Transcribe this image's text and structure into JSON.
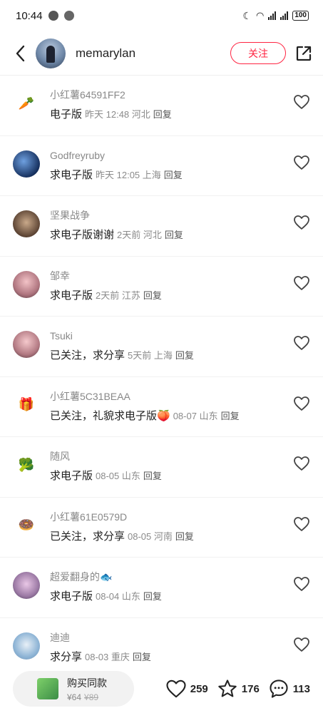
{
  "status_bar": {
    "time": "10:44",
    "battery": "100"
  },
  "header": {
    "username": "memarylan",
    "follow_label": "关注"
  },
  "comments": [
    {
      "name": "小红薯64591FF2",
      "text": "电子版",
      "meta": "昨天 12:48 河北",
      "reply": "回复",
      "avatar": "carrot-avatar",
      "emoji": "🥕"
    },
    {
      "name": "Godfreyruby",
      "text": "求电子版",
      "meta": "昨天 12:05 上海",
      "reply": "回复",
      "avatar": "photo-avatar",
      "emoji": ""
    },
    {
      "name": "坚果战争",
      "text": "求电子版谢谢",
      "meta": "2天前 河北",
      "reply": "回复",
      "avatar": "photo-avatar",
      "emoji": ""
    },
    {
      "name": "邹幸",
      "text": "求电子版",
      "meta": "2天前 江苏",
      "reply": "回复",
      "avatar": "photo-avatar",
      "emoji": ""
    },
    {
      "name": "Tsuki",
      "text": "已关注，求分享",
      "meta": "5天前 上海",
      "reply": "回复",
      "avatar": "photo-avatar",
      "emoji": ""
    },
    {
      "name": "小红薯5C31BEAA",
      "text": "已关注，礼貌求电子版🍑",
      "meta": "08-07 山东",
      "reply": "回复",
      "avatar": "gift-avatar",
      "emoji": "🎁"
    },
    {
      "name": "随风",
      "text": "求电子版",
      "meta": "08-05 山东",
      "reply": "回复",
      "avatar": "broccoli-avatar",
      "emoji": "🥦"
    },
    {
      "name": "小红薯61E0579D",
      "text": "已关注，求分享",
      "meta": "08-05 河南",
      "reply": "回复",
      "avatar": "donut-avatar",
      "emoji": "🍩"
    },
    {
      "name": "超爱翻身的🐟",
      "text": "求电子版",
      "meta": "08-04 山东",
      "reply": "回复",
      "avatar": "photo-avatar",
      "emoji": ""
    },
    {
      "name": "迪迪",
      "text": "求分享",
      "meta": "08-03 重庆",
      "reply": "回复",
      "avatar": "photo-avatar",
      "emoji": ""
    }
  ],
  "bottom_bar": {
    "buy_title": "购买同款",
    "price": "¥64",
    "old_price": "¥89",
    "likes": "259",
    "stars": "176",
    "comments": "113"
  },
  "colors": {
    "accent": "#ff2442"
  }
}
